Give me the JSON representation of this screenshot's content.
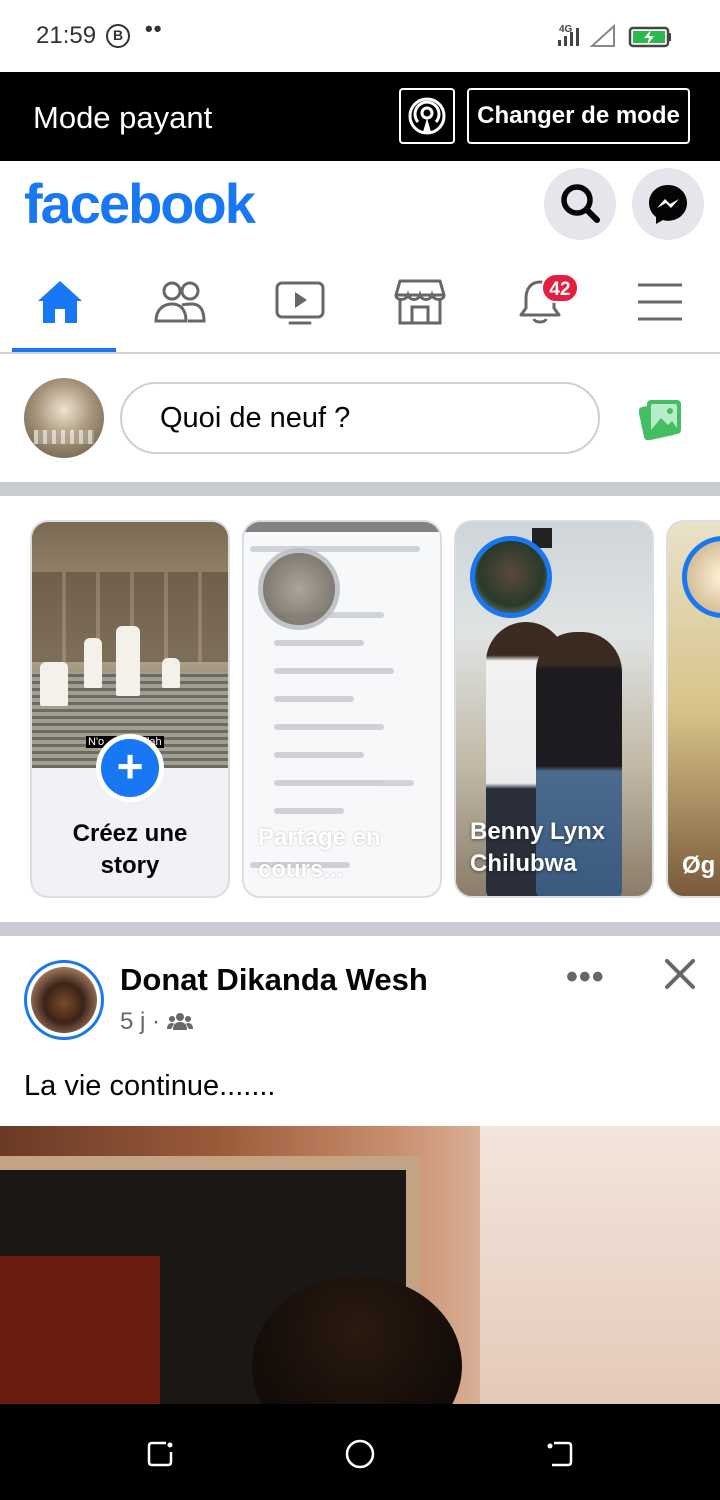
{
  "status_bar": {
    "time": "21:59",
    "badge_letter": "B",
    "dots": "••",
    "network": "4G",
    "icons": [
      "signal-icon",
      "wifi-icon",
      "battery-charging-icon"
    ]
  },
  "mode_banner": {
    "label": "Mode payant",
    "icon": "radio-tower-icon",
    "change_button": "Changer de mode"
  },
  "header": {
    "logo": "facebook",
    "brand_color": "#1877f2",
    "icons": [
      "search-icon",
      "messenger-icon"
    ]
  },
  "nav": {
    "tabs": [
      {
        "name": "home",
        "icon": "home-icon",
        "active": true
      },
      {
        "name": "friends",
        "icon": "friends-icon",
        "active": false
      },
      {
        "name": "watch",
        "icon": "video-icon",
        "active": false
      },
      {
        "name": "marketplace",
        "icon": "shop-icon",
        "active": false
      },
      {
        "name": "notifications",
        "icon": "bell-icon",
        "active": false
      },
      {
        "name": "menu",
        "icon": "menu-icon",
        "active": false
      }
    ],
    "notification_count": "42"
  },
  "composer": {
    "placeholder": "Quoi de neuf ?",
    "photo_icon": "photo-icon"
  },
  "stories": {
    "create": {
      "label_line1": "Créez une",
      "label_line2": "story",
      "photo_caption": "N'o           Allah"
    },
    "items": [
      {
        "caption_line1": "Partage en",
        "caption_line2": "cours..."
      },
      {
        "caption_line1": "Benny Lynx",
        "caption_line2": "Chilubwa"
      },
      {
        "caption_line1": "Øg",
        "caption_line2": ""
      }
    ]
  },
  "post": {
    "author": "Donat Dikanda Wesh",
    "time": "5 j",
    "separator": "·",
    "audience_icon": "friends-audience-icon",
    "text": "La vie continue......."
  },
  "system_nav": {
    "buttons": [
      "recent-apps-icon",
      "home-circle-icon",
      "back-icon"
    ]
  }
}
